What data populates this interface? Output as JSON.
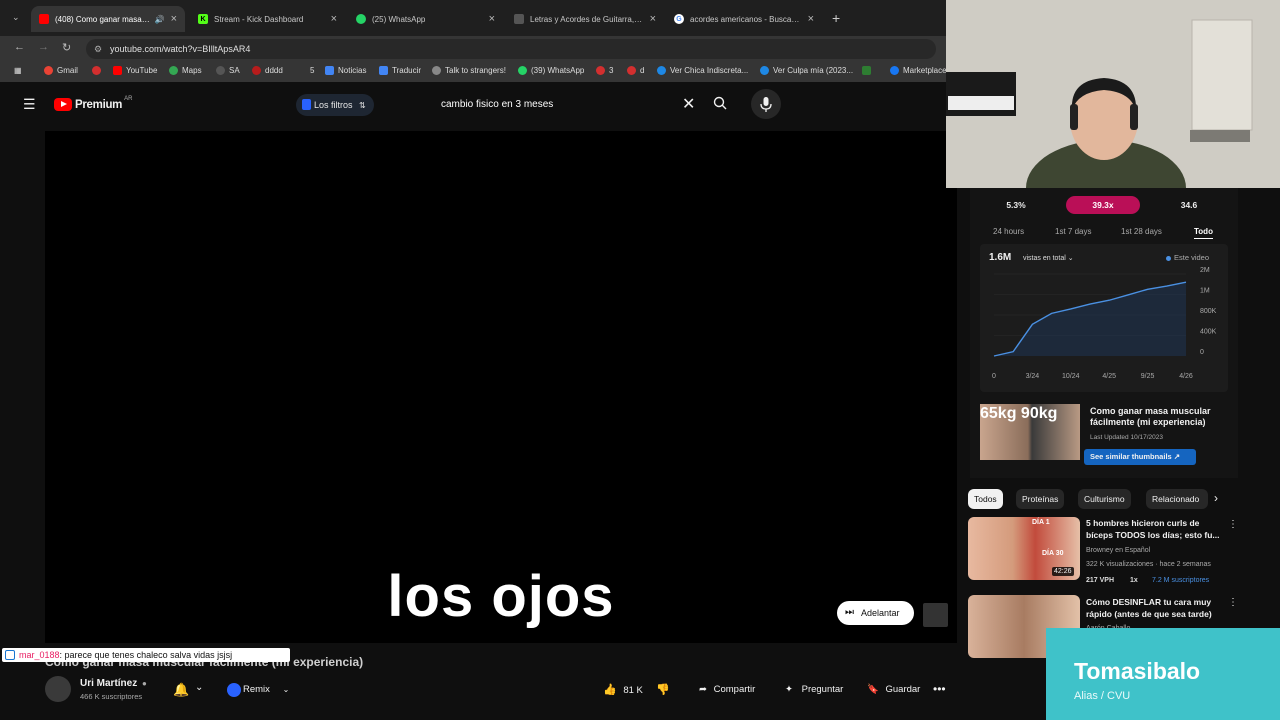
{
  "browser": {
    "tabs": [
      {
        "title": "(408) Como ganar masa mu...",
        "active": true
      },
      {
        "title": "Stream - Kick Dashboard"
      },
      {
        "title": "(25) WhatsApp"
      },
      {
        "title": "Letras y Acordes de Guitarra, P..."
      },
      {
        "title": "acordes americanos - Buscar co..."
      }
    ],
    "new_tab": "+",
    "url": "youtube.com/watch?v=BIlltApsAR4",
    "bookmarks": [
      "Gmail",
      "YouTube",
      "Maps",
      "SA",
      "dddd",
      "5",
      "Noticias",
      "Traducir",
      "Talk to strangers!",
      "(39) WhatsApp",
      "3",
      "d",
      "Ver Chica Indiscreta...",
      "Ver Culpa mía (2023...",
      "Marketplace"
    ]
  },
  "youtube": {
    "logo": "Premium",
    "logo_region": "AR",
    "filters": "Los filtros",
    "search_query": "cambio fisico en 3 meses",
    "caption": "los ojos",
    "skip_label": "Adelantar",
    "video_title": "Como ganar masa muscular fácilmente (mi experiencia)",
    "channel": {
      "name": "Uri Martínez",
      "subs": "466 K suscriptores"
    },
    "remix": "Remix",
    "likes": "81 K",
    "share": "Compartir",
    "ask": "Preguntar",
    "save": "Guardar"
  },
  "chat": {
    "user": "mar_0188",
    "message": ": parece que tenes chaleco salva vidas jsjsj"
  },
  "vidiq": {
    "stats": [
      "5.3%",
      "39.3x",
      "34.6"
    ],
    "periods": [
      "24 hours",
      "1st 7 days",
      "1st 28 days",
      "Todo"
    ],
    "total_views": "1.6M",
    "views_label": "vistas en total",
    "legend": "Este video",
    "card_title": "Como ganar masa muscular fácilmente (mi experiencia)",
    "card_updated": "Last Updated 10/17/2023",
    "card_button": "See similar thumbnails",
    "thumb_text": "65kg 90kg",
    "accent": "#ba0f57"
  },
  "chart_data": {
    "type": "line",
    "x_ticks": [
      "0",
      "3/24",
      "10/24",
      "4/25",
      "9/25",
      "4/26"
    ],
    "y_ticks": [
      "2M",
      "1M",
      "800K",
      "400K",
      "0"
    ],
    "series": [
      {
        "values": [
          0,
          0.08,
          0.58,
          0.78,
          0.86,
          0.95,
          1.02,
          1.12,
          1.22,
          1.28,
          1.35
        ]
      }
    ]
  },
  "recommendations": {
    "chips": [
      "Todos",
      "Proteínas",
      "Culturismo",
      "Relacionado"
    ],
    "items": [
      {
        "title": "5 hombres hicieron curls de bíceps TODOS los días; esto fu...",
        "channel": "Browney en Español",
        "meta": "322 K visualizaciones · hace 2 semanas",
        "duration": "42:26",
        "badge1": "DÍA 1",
        "badge2": "DÍA 30",
        "tags": [
          "217 VPH",
          "1x",
          "7.2 M suscriptores"
        ]
      },
      {
        "title": "Cómo DESINFLAR tu cara muy rápido (antes de que sea tarde)",
        "channel": "Aarón Caballo"
      }
    ]
  },
  "donation": {
    "name": "Tomasibalo",
    "sub": "Alias / CVU"
  }
}
